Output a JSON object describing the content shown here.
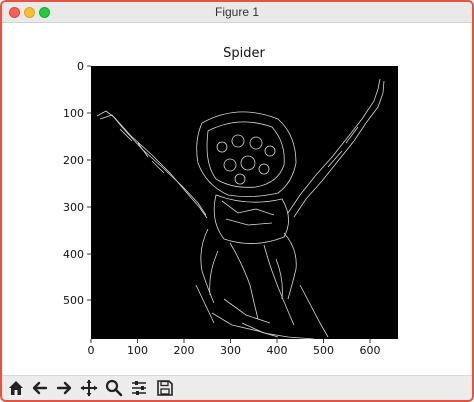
{
  "window": {
    "title": "Figure 1"
  },
  "figure": {
    "title": "Spider",
    "image_type": "canny edge detection, white edges on black background",
    "x_ticks": [
      "0",
      "100",
      "200",
      "300",
      "400",
      "500",
      "600"
    ],
    "y_ticks": [
      "0",
      "100",
      "200",
      "300",
      "400",
      "500"
    ],
    "xlim": [
      0,
      660
    ],
    "ylim": [
      585,
      0
    ]
  },
  "toolbar": {
    "buttons": [
      {
        "name": "home-icon",
        "tooltip": "Home"
      },
      {
        "name": "back-arrow-icon",
        "tooltip": "Back"
      },
      {
        "name": "forward-arrow-icon",
        "tooltip": "Forward"
      },
      {
        "name": "pan-icon",
        "tooltip": "Pan"
      },
      {
        "name": "zoom-icon",
        "tooltip": "Zoom"
      },
      {
        "name": "subplots-icon",
        "tooltip": "Configure subplots"
      },
      {
        "name": "save-icon",
        "tooltip": "Save"
      }
    ]
  }
}
